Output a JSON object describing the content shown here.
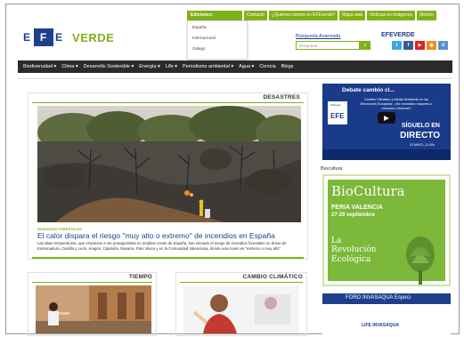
{
  "topbar": {
    "edition_label": "Ediciones:",
    "links": [
      "Contacto",
      "¿Quiénes somos en EFEverde?",
      "Mapa web",
      "Noticias en imágenes",
      "México"
    ]
  },
  "editions_dropdown": [
    "España",
    "Internacional",
    "Galego"
  ],
  "logo": {
    "verde": "VERDE"
  },
  "search": {
    "advanced_label": "Búsqueda Avanzada",
    "placeholder": "Búsqueda ..."
  },
  "efeverde_label": "EFEVERDE",
  "nav": [
    "Biodiversidad ▾",
    "Clima ▾",
    "Desarrollo Sostenible ▾",
    "Energía ▾",
    "Life ▾",
    "Periodismo ambiental ▾",
    "Agua ▾",
    "Ciencia",
    "Blogs"
  ],
  "feature": {
    "section": "DESASTRES",
    "kicker": "INCENDIOS FORESTALES",
    "headline": "El calor dispara el riesgo \"muy alto o extremo\" de incendios en España",
    "teaser": "Las altas temperaturas, que empiezan a ser protagonistas en amplias zonas de España, han elevado el riesgo de incendios forestales en áreas de Extremadura, Castilla y León, Aragón, Cataluña, Navarra, País Vasco y en la Comunidad Valenciana, donde este lunes es \"extremo o muy alto\"."
  },
  "cards": [
    {
      "section": "TIEMPO"
    },
    {
      "section": "CAMBIO CLIMÁTICO"
    }
  ],
  "video": {
    "title": "Debate cambio cl...",
    "subtitle": "Cambio Climático y Medio Ambiente en las Elecciones Europeas: ¿Se necesitan mayores o menores reformas?",
    "efe_small": "Diálogos",
    "efe": "EFE",
    "siguelo": "SÍGUELO EN",
    "directo": "DIRECTO",
    "date": "23 MAYO_11:00h"
  },
  "biocultura": {
    "label": "Biocultura",
    "name": "BioCultura",
    "feria": "FERIA VALENCIA",
    "dates": "27-29 septiembre",
    "tagline_1": "La",
    "tagline_2": "Revolución",
    "tagline_3": "Ecológica"
  },
  "foro": {
    "title": "FORO INVASAQUA Especi",
    "life": "LIFE INVASAQUA"
  },
  "colors": {
    "green": "#7fb218",
    "blue": "#1d3f8e",
    "nav": "#2b2b2b"
  }
}
